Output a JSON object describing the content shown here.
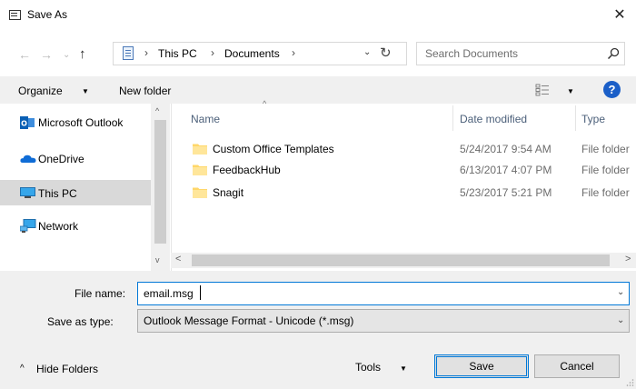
{
  "window": {
    "title": "Save As",
    "close_glyph": "✕"
  },
  "nav": {
    "back_glyph": "←",
    "forward_glyph": "→",
    "recent_glyph": "⌄",
    "up_glyph": "↑"
  },
  "address": {
    "separator": "›",
    "crumbs": [
      "This PC",
      "Documents"
    ],
    "dropdown_glyph": "⌄",
    "refresh_glyph": "↻"
  },
  "search": {
    "placeholder": "Search Documents"
  },
  "toolbar": {
    "organize_label": "Organize",
    "new_folder_label": "New folder",
    "caret": "▼",
    "help_label": "?"
  },
  "sidebar": {
    "items": [
      {
        "label": "Microsoft Outlook",
        "icon": "outlook-icon"
      },
      {
        "label": "OneDrive",
        "icon": "onedrive-icon"
      },
      {
        "label": "This PC",
        "icon": "computer-icon",
        "selected": true
      },
      {
        "label": "Network",
        "icon": "network-icon"
      }
    ]
  },
  "filelist": {
    "columns": {
      "name": "Name",
      "date": "Date modified",
      "type": "Type"
    },
    "sort_glyph": "^",
    "rows": [
      {
        "name": "Custom Office Templates",
        "date": "5/24/2017 9:54 AM",
        "type": "File folder"
      },
      {
        "name": "FeedbackHub",
        "date": "6/13/2017 4:07 PM",
        "type": "File folder"
      },
      {
        "name": "Snagit",
        "date": "5/23/2017 5:21 PM",
        "type": "File folder"
      }
    ]
  },
  "scroll": {
    "up": "^",
    "down": "v",
    "left": "<",
    "right": ">"
  },
  "form": {
    "file_name_label": "File name:",
    "file_name_value": "email.msg",
    "save_type_label": "Save as type:",
    "save_type_value": "Outlook Message Format - Unicode (*.msg)",
    "dropdown_glyph": "⌄"
  },
  "footer": {
    "hide_folders_caret": "^",
    "hide_folders_label": "Hide Folders",
    "tools_label": "Tools",
    "save_label": "Save",
    "cancel_label": "Cancel"
  },
  "colors": {
    "accent": "#0078d7",
    "selection": "#d9d9d9",
    "folder": "#ffd769",
    "help": "#1b5fc8"
  }
}
